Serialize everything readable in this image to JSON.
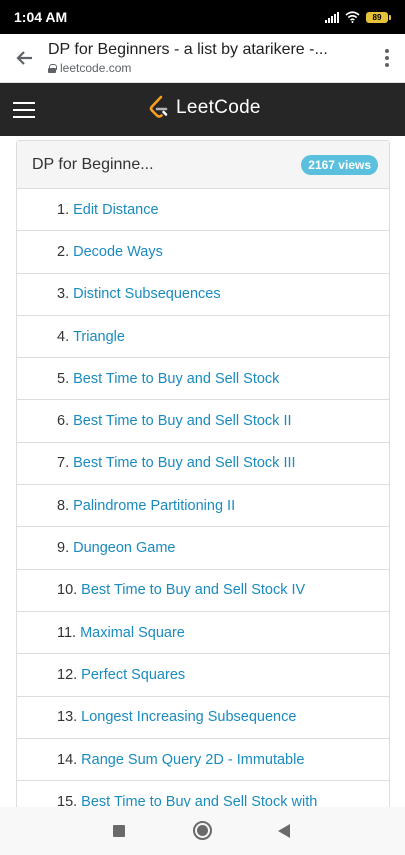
{
  "status": {
    "time": "1:04 AM",
    "battery": "89"
  },
  "browser": {
    "page_title": "DP for Beginners - a list by atarikere -...",
    "domain": "leetcode.com"
  },
  "site": {
    "logo_text": "LeetCode"
  },
  "list": {
    "title": "DP for Beginne...",
    "views": "2167 views",
    "items": [
      {
        "num": "1.",
        "name": "Edit Distance"
      },
      {
        "num": "2.",
        "name": "Decode Ways"
      },
      {
        "num": "3.",
        "name": "Distinct Subsequences"
      },
      {
        "num": "4.",
        "name": "Triangle"
      },
      {
        "num": "5.",
        "name": "Best Time to Buy and Sell Stock"
      },
      {
        "num": "6.",
        "name": "Best Time to Buy and Sell Stock II"
      },
      {
        "num": "7.",
        "name": "Best Time to Buy and Sell Stock III"
      },
      {
        "num": "8.",
        "name": "Palindrome Partitioning II"
      },
      {
        "num": "9.",
        "name": "Dungeon Game"
      },
      {
        "num": "10.",
        "name": "Best Time to Buy and Sell Stock IV"
      },
      {
        "num": "11.",
        "name": "Maximal Square"
      },
      {
        "num": "12.",
        "name": "Perfect Squares"
      },
      {
        "num": "13.",
        "name": "Longest Increasing Subsequence"
      },
      {
        "num": "14.",
        "name": "Range Sum Query 2D - Immutable"
      },
      {
        "num": "15.",
        "name": "Best Time to Buy and Sell Stock with"
      }
    ]
  },
  "colors": {
    "link": "#1a8bbf",
    "badge": "#5bc0de",
    "header_bg": "#262626",
    "logo_orange": "#f89f1b"
  }
}
